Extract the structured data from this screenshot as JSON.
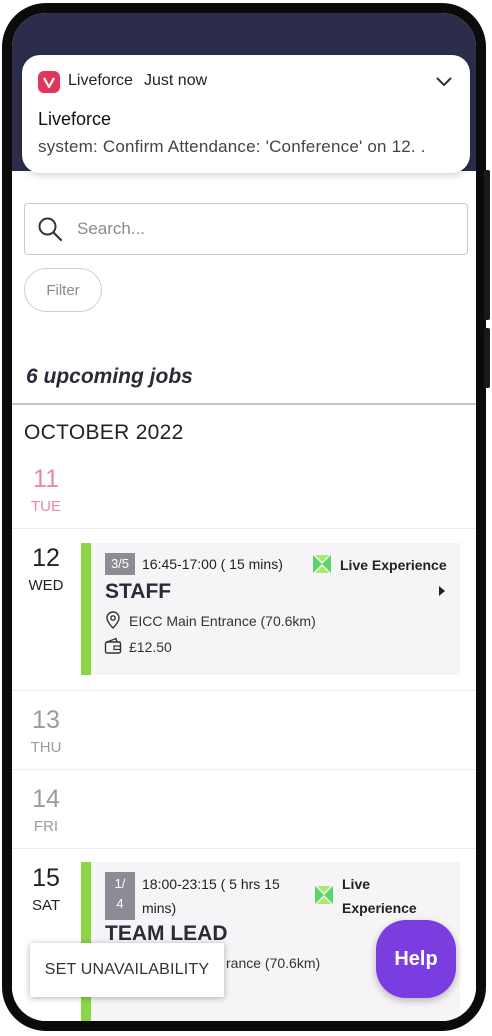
{
  "notification": {
    "app_name": "Liveforce",
    "time": "Just now",
    "title": "Liveforce",
    "body": "system: Confirm Attendance: 'Conference' on 12. ."
  },
  "search": {
    "placeholder": "Search..."
  },
  "filter_label": "Filter",
  "upcoming_label": "6 upcoming jobs",
  "month_label": "OCTOBER 2022",
  "days": [
    {
      "num": "11",
      "day": "TUE"
    },
    {
      "num": "12",
      "day": "WED"
    },
    {
      "num": "13",
      "day": "THU"
    },
    {
      "num": "14",
      "day": "FRI"
    },
    {
      "num": "15",
      "day": "SAT"
    }
  ],
  "jobs": [
    {
      "badge": "3/5",
      "time": "16:45-17:00 ( 15 mins)",
      "role": "STAFF",
      "location": "EICC Main Entrance (70.6km)",
      "pay": "£12.50",
      "brand": "Live Experience"
    },
    {
      "badge_top": "1/",
      "badge_bottom": "4",
      "time_line1": "18:00-23:15 ( 5 hrs 15",
      "time_line2": "mins)",
      "role": "TEAM LEAD",
      "location_partial": "rance (70.6km)",
      "brand_line1": "Live",
      "brand_line2": "Experience"
    }
  ],
  "help_label": "Help",
  "unavailability_label": "SET UNAVAILABILITY",
  "colors": {
    "header": "#2c2d4a",
    "accent_green": "#8bd645",
    "help_purple": "#7a3ddf",
    "past_day": "#e58aa5",
    "muted_day": "#9a9aa3"
  }
}
